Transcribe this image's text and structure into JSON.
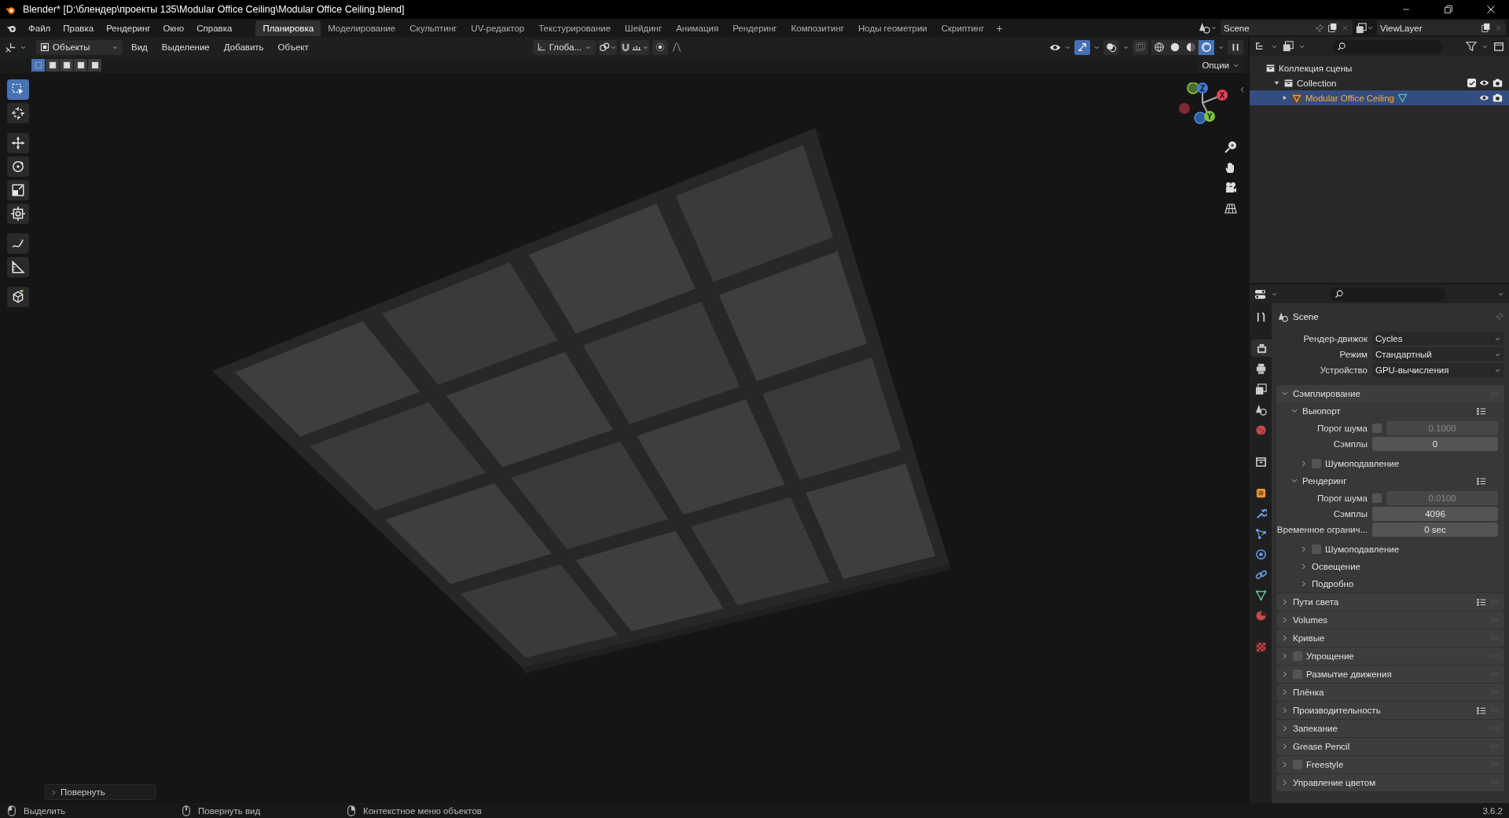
{
  "window": {
    "title": "Blender* [D:\\блендер\\проекты 135\\Modular Office Ceiling\\Modular Office Ceiling.blend]"
  },
  "menu": [
    "Файл",
    "Правка",
    "Рендеринг",
    "Окно",
    "Справка"
  ],
  "workspaces": [
    {
      "label": "Планировка",
      "selected": true
    },
    {
      "label": "Моделирование",
      "selected": false
    },
    {
      "label": "Скульптинг",
      "selected": false
    },
    {
      "label": "UV-редактор",
      "selected": false
    },
    {
      "label": "Текстурирование",
      "selected": false
    },
    {
      "label": "Шейдинг",
      "selected": false
    },
    {
      "label": "Анимация",
      "selected": false
    },
    {
      "label": "Рендеринг",
      "selected": false
    },
    {
      "label": "Композитинг",
      "selected": false
    },
    {
      "label": "Ноды геометрии",
      "selected": false
    },
    {
      "label": "Скриптинг",
      "selected": false
    }
  ],
  "add_workspace": "+",
  "scene": "Scene",
  "view_layer": "ViewLayer",
  "viewport": {
    "mode": "Объекты",
    "menus": [
      "Вид",
      "Выделение",
      "Добавить",
      "Объект"
    ],
    "orientation": "Глоба...",
    "options": "Опции",
    "gizmos_on": true,
    "overlays_on": false,
    "shading_modes": [
      {
        "selected": false
      },
      {
        "selected": false
      },
      {
        "selected": false
      },
      {
        "selected": true
      }
    ],
    "select_modes": [
      {
        "selected": true
      },
      {
        "selected": false
      },
      {
        "selected": false
      },
      {
        "selected": false
      },
      {
        "selected": false
      }
    ],
    "tools": [
      {
        "kind": "select_box",
        "selected": true
      },
      {
        "kind": "cursor",
        "selected": false
      },
      {
        "kind": "move",
        "selected": false
      },
      {
        "kind": "rotate",
        "selected": false
      },
      {
        "kind": "scale",
        "selected": false
      },
      {
        "kind": "transform",
        "selected": false
      },
      {
        "kind": "annotate",
        "selected": false
      },
      {
        "kind": "measure",
        "selected": false
      },
      {
        "kind": "add_cube",
        "selected": false
      }
    ],
    "gizmo_axes": [
      "Z",
      "X",
      "Y"
    ],
    "last_operator": "Повернуть"
  },
  "outliner": {
    "tree": [
      {
        "label": "Коллекция сцены",
        "kind": "scene_collection",
        "selected": false,
        "children": [
          {
            "label": "Collection",
            "kind": "collection",
            "selected": false,
            "expanded": true,
            "checked": true,
            "children": [
              {
                "label": "Modular Office Ceiling",
                "kind": "object",
                "selected": true,
                "expanded": false
              }
            ]
          }
        ]
      }
    ]
  },
  "properties": {
    "tabs": [
      {
        "kind": "tool",
        "selected": false
      },
      {
        "kind": "render",
        "selected": true
      },
      {
        "kind": "output",
        "selected": false
      },
      {
        "kind": "view_layer",
        "selected": false
      },
      {
        "kind": "scene",
        "selected": false
      },
      {
        "kind": "world",
        "selected": false
      },
      {
        "kind": "collection",
        "selected": false
      },
      {
        "kind": "object",
        "selected": false
      },
      {
        "kind": "modifier",
        "selected": false
      },
      {
        "kind": "particles",
        "selected": false
      },
      {
        "kind": "physics",
        "selected": false
      },
      {
        "kind": "constraints",
        "selected": false
      },
      {
        "kind": "data",
        "selected": false
      },
      {
        "kind": "material",
        "selected": false
      },
      {
        "kind": "texture",
        "selected": false
      }
    ],
    "context": "Scene",
    "fields": [
      {
        "kind": "dropdown",
        "label": "Рендер-движок",
        "value": "Cycles"
      },
      {
        "kind": "dropdown",
        "label": "Режим",
        "value": "Стандартный"
      },
      {
        "kind": "dropdown",
        "label": "Устройство",
        "value": "GPU-вычисления"
      }
    ],
    "panels": [
      {
        "title": "Сэмплирование",
        "expanded": true,
        "presets": false,
        "children": [
          {
            "title": "Выюпорт",
            "expanded": true,
            "presets": true,
            "rows": [
              {
                "kind": "number",
                "label": "Порог шума",
                "checked": false,
                "value": "0.1000",
                "disabled": true
              },
              {
                "kind": "number",
                "label": "Сэмплы",
                "value": "0",
                "disabled": false
              }
            ],
            "children": [
              {
                "title": "Шумоподавление",
                "expanded": false,
                "presets": false,
                "checked": false
              }
            ]
          },
          {
            "title": "Рендеринг",
            "expanded": true,
            "presets": true,
            "rows": [
              {
                "kind": "number",
                "label": "Порог шума",
                "checked": false,
                "value": "0.0100",
                "disabled": true
              },
              {
                "kind": "number",
                "label": "Сэмплы",
                "value": "4096",
                "disabled": false
              },
              {
                "kind": "number",
                "label": "Временное огранич...",
                "value": "0 sec",
                "disabled": false
              }
            ],
            "children": [
              {
                "title": "Шумоподавление",
                "expanded": false,
                "presets": false,
                "checked": false
              },
              {
                "title": "Освещение",
                "expanded": false,
                "presets": false
              },
              {
                "title": "Подробно",
                "expanded": false,
                "presets": false
              }
            ]
          }
        ]
      },
      {
        "title": "Пути света",
        "expanded": false,
        "presets": true
      },
      {
        "title": "Volumes",
        "expanded": false,
        "presets": false
      },
      {
        "title": "Кривые",
        "expanded": false,
        "presets": false
      },
      {
        "title": "Упрощение",
        "expanded": false,
        "presets": false,
        "checked": false
      },
      {
        "title": "Размытие движения",
        "expanded": false,
        "presets": false,
        "checked": false
      },
      {
        "title": "Плёнка",
        "expanded": false,
        "presets": false
      },
      {
        "title": "Производительность",
        "expanded": false,
        "presets": true
      },
      {
        "title": "Запекание",
        "expanded": false,
        "presets": false
      },
      {
        "title": "Grease Pencil",
        "expanded": false,
        "presets": false
      },
      {
        "title": "Freestyle",
        "expanded": false,
        "presets": false,
        "checked": false
      },
      {
        "title": "Управление цветом",
        "expanded": false,
        "presets": false
      }
    ]
  },
  "status_bar": {
    "hints": [
      "Выделить",
      "Повернуть вид",
      "Контекстное меню объектов"
    ],
    "version": "3.6.2"
  }
}
